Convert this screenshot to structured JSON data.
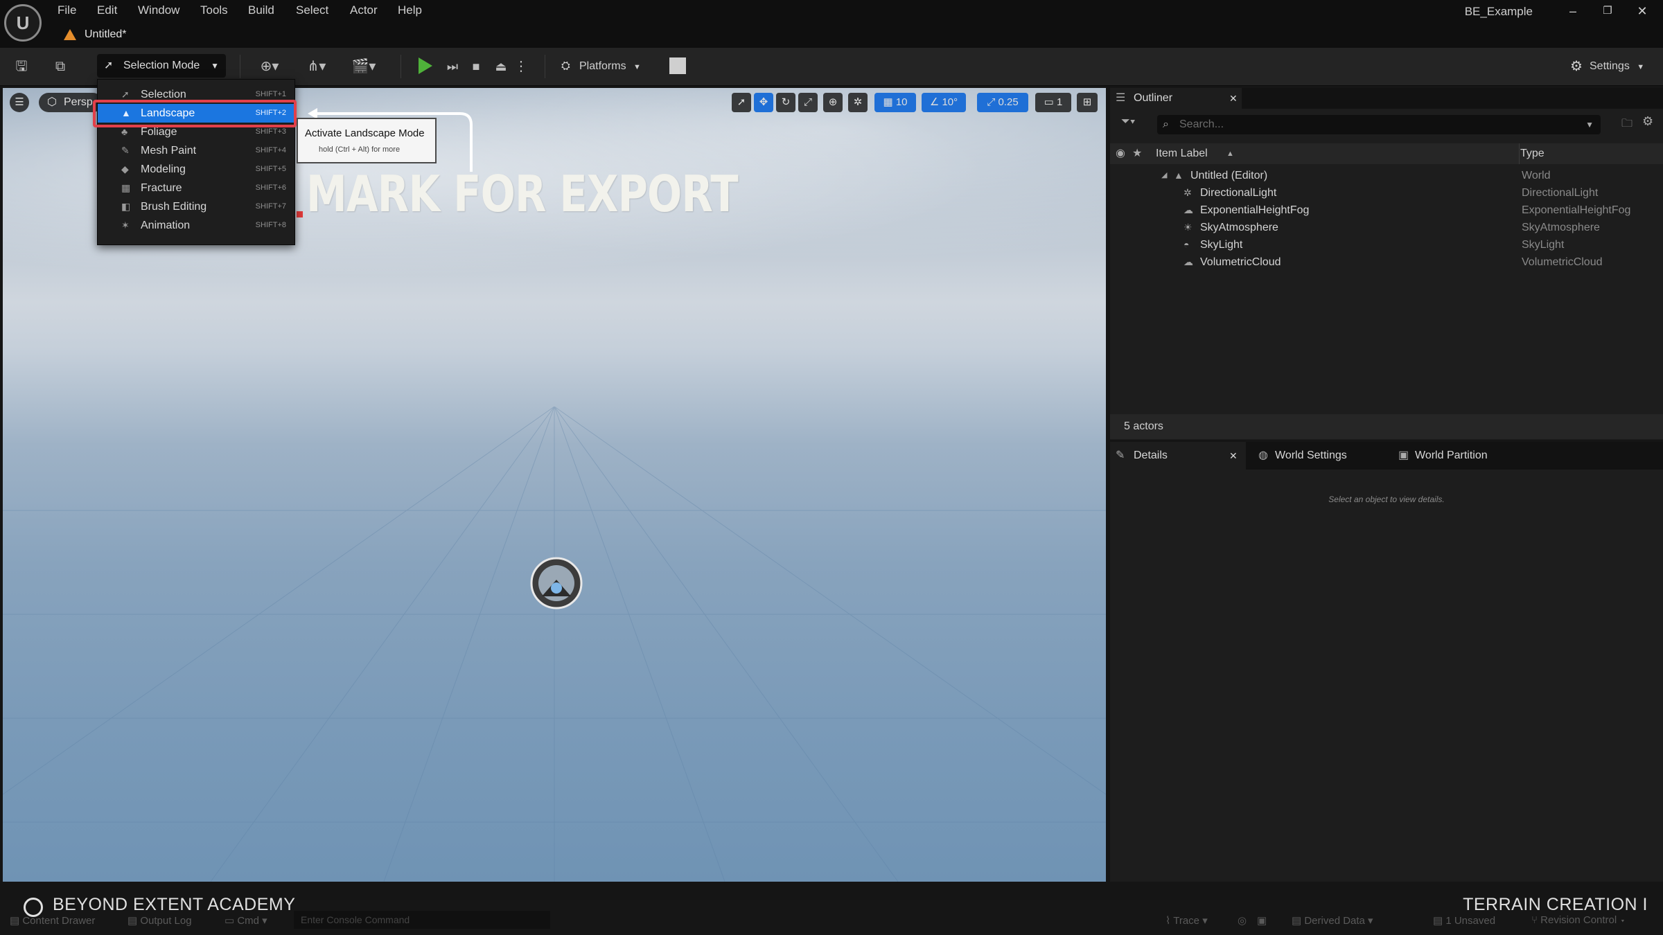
{
  "app": {
    "project_name": "BE_Example",
    "logo_text": "U"
  },
  "menubar": [
    "File",
    "Edit",
    "Window",
    "Tools",
    "Build",
    "Select",
    "Actor",
    "Help"
  ],
  "document_tab": {
    "label": "Untitled*"
  },
  "window_controls": {
    "minimize": "–",
    "restore": "❐",
    "close": "✕"
  },
  "toolbar": {
    "selection_mode": "Selection Mode",
    "platforms": "Platforms",
    "settings": "Settings"
  },
  "mode_menu": {
    "items": [
      {
        "label": "Selection",
        "shortcut": "SHIFT+1",
        "icon": "selection-icon"
      },
      {
        "label": "Landscape",
        "shortcut": "SHIFT+2",
        "icon": "landscape-icon",
        "selected": true
      },
      {
        "label": "Foliage",
        "shortcut": "SHIFT+3",
        "icon": "foliage-icon"
      },
      {
        "label": "Mesh Paint",
        "shortcut": "SHIFT+4",
        "icon": "brush-icon"
      },
      {
        "label": "Modeling",
        "shortcut": "SHIFT+5",
        "icon": "modeling-icon"
      },
      {
        "label": "Fracture",
        "shortcut": "SHIFT+6",
        "icon": "fracture-icon"
      },
      {
        "label": "Brush Editing",
        "shortcut": "SHIFT+7",
        "icon": "brush-editing-icon"
      },
      {
        "label": "Animation",
        "shortcut": "SHIFT+8",
        "icon": "animation-icon"
      }
    ]
  },
  "tooltip": {
    "title": "Activate Landscape Mode",
    "hint": "hold (Ctrl + Alt) for more"
  },
  "viewport": {
    "perspective_label": "Persp",
    "overlay_text": "MARK FOR EXPORT",
    "grid_snap": "10",
    "rotation_snap": "10°",
    "scale_snap": "0.25",
    "camera_speed": "1",
    "colors": {
      "accent": "#1f6fd6",
      "highlight": "#e2404a",
      "selected": "#1b76e0"
    }
  },
  "outliner": {
    "tab_label": "Outliner",
    "search_placeholder": "Search...",
    "columns": {
      "label": "Item Label",
      "type": "Type"
    },
    "rows": [
      {
        "label": "Untitled (Editor)",
        "type": "World"
      },
      {
        "label": "DirectionalLight",
        "type": "DirectionalLight"
      },
      {
        "label": "ExponentialHeightFog",
        "type": "ExponentialHeightFog"
      },
      {
        "label": "SkyAtmosphere",
        "type": "SkyAtmosphere"
      },
      {
        "label": "SkyLight",
        "type": "SkyLight"
      },
      {
        "label": "VolumetricCloud",
        "type": "VolumetricCloud"
      }
    ],
    "actor_count": "5 actors"
  },
  "details": {
    "tabs": [
      "Details",
      "World Settings",
      "World Partition"
    ],
    "empty_hint": "Select an object to view details."
  },
  "statusbar": {
    "content_drawer": "Content Drawer",
    "output_log": "Output Log",
    "cmd": "Cmd",
    "console_placeholder": "Enter Console Command",
    "trace": "Trace",
    "derived_data": "Derived Data",
    "unsaved": "1 Unsaved",
    "revision_control": "Revision Control"
  },
  "watermarks": {
    "left": "BEYOND EXTENT ACADEMY",
    "right": "TERRAIN CREATION I"
  }
}
